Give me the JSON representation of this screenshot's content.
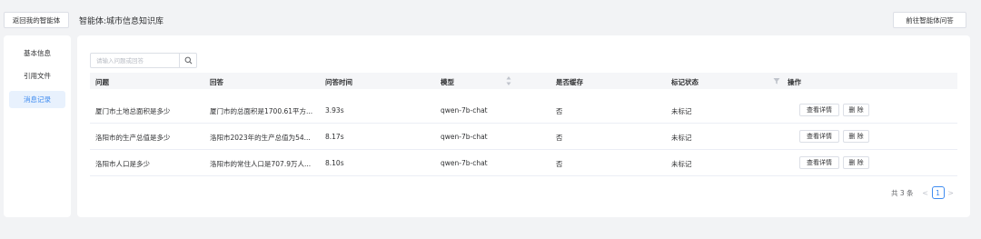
{
  "header": {
    "back_label": "返回我的智能体",
    "title": "智能体:城市信息知识库",
    "goto_label": "前往智能体问答"
  },
  "sidebar": {
    "items": [
      {
        "label": "基本信息",
        "active": false
      },
      {
        "label": "引用文件",
        "active": false
      },
      {
        "label": "消息记录",
        "active": true
      }
    ]
  },
  "search": {
    "placeholder": "请输入问题或回答",
    "value": ""
  },
  "table": {
    "columns": [
      "问题",
      "回答",
      "问答时间",
      "模型",
      "是否缓存",
      "标记状态",
      "操作"
    ],
    "rows": [
      {
        "question": "厦门市土地总面积是多少",
        "answer": "厦门市的总面积是1700.61平方...",
        "time": "3.93s",
        "model": "qwen-7b-chat",
        "cached": "否",
        "status": "未标记"
      },
      {
        "question": "洛阳市的生产总值是多少",
        "answer": "洛阳市2023年的生产总值为54...",
        "time": "8.17s",
        "model": "qwen-7b-chat",
        "cached": "否",
        "status": "未标记"
      },
      {
        "question": "洛阳市人口是多少",
        "answer": "洛阳市的常住人口是707.9万人...",
        "time": "8.10s",
        "model": "qwen-7b-chat",
        "cached": "否",
        "status": "未标记"
      }
    ],
    "actions": {
      "detail": "查看详情",
      "delete": "删 除"
    }
  },
  "pagination": {
    "total": "共 3 条",
    "current_page": "1",
    "prev": "<",
    "next": ">"
  },
  "colors": {
    "accent": "#3f8cf0",
    "background": "#f2f3f5",
    "active_bg": "#e8f1fd"
  }
}
